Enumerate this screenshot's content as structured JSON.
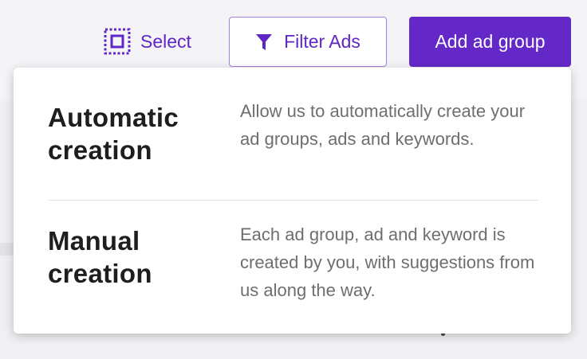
{
  "toolbar": {
    "select_label": "Select",
    "filter_label": "Filter Ads",
    "add_label": "Add ad group"
  },
  "icons": {
    "select": "select-dashed-square-icon",
    "filter": "funnel-filter-icon"
  },
  "colors": {
    "accent": "#6428c8",
    "accent_text": "#6026c4",
    "filter_border": "#a37fe0"
  },
  "dropdown": {
    "options": [
      {
        "title": "Automatic creation",
        "description": "Allow us to automatically create your ad groups, ads and keywords."
      },
      {
        "title": "Manual creation",
        "description": "Each ad group, ad and keyword is created by you, with suggestions from us along the way."
      }
    ]
  }
}
